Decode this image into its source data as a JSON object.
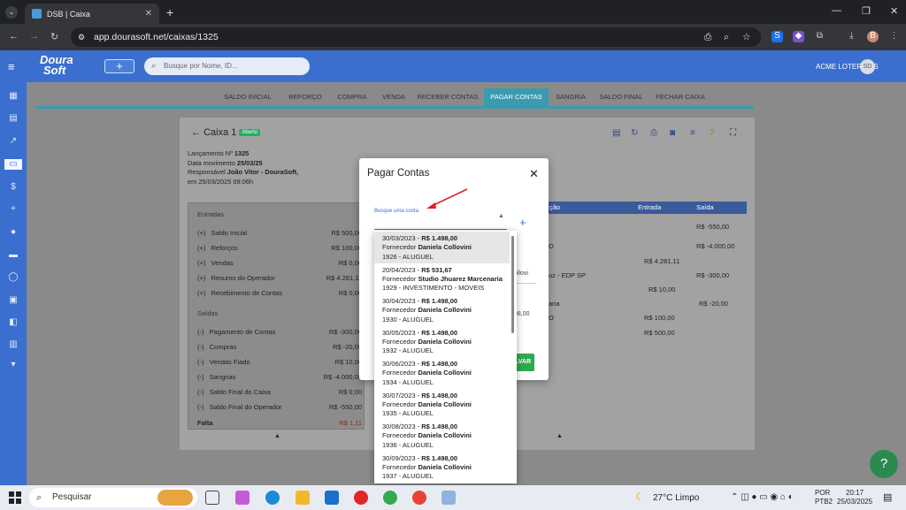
{
  "browser": {
    "tab_title": "DSB | Caixa",
    "url": "app.dourasoft.net/caixas/1325"
  },
  "app": {
    "logo_line1": "Doura",
    "logo_line2": "Soft",
    "add_label": "+",
    "search_placeholder": "Busque por Nome, ID...",
    "company": "ACME LOTERICAS",
    "avatar_initials": "SD"
  },
  "tabs": [
    "SALDO INICIAL",
    "REFORÇO",
    "COMPRA",
    "VENDA",
    "RECEBER CONTAS",
    "PAGAR CONTAS",
    "SANGRIA",
    "SALDO FINAL",
    "FECHAR CAIXA"
  ],
  "active_tab": "PAGAR CONTAS",
  "caixa": {
    "title": "Caixa 1",
    "status": "Aberto",
    "lancamento_label": "Lançamento Nº",
    "lancamento": "1325",
    "data_label": "Data movimento",
    "data": "25/03/25",
    "responsavel_label": "Responsável",
    "responsavel": "João Vitor - DouraSoft,",
    "em": "em 25/03/2025 09:06h"
  },
  "summary": {
    "entradas_label": "Entradas",
    "entradas": [
      {
        "sign": "(+)",
        "label": "Saldo Inicial",
        "value": "R$ 500,00"
      },
      {
        "sign": "(+)",
        "label": "Reforços",
        "value": "R$ 100,00"
      },
      {
        "sign": "(+)",
        "label": "Vendas",
        "value": "R$ 0,00"
      },
      {
        "sign": "(+)",
        "label": "Resumo do Operador",
        "value": "R$ 4.281,11"
      },
      {
        "sign": "(+)",
        "label": "Recebimento de Contas",
        "value": "R$ 0,00"
      }
    ],
    "saidas_label": "Saídas",
    "saidas": [
      {
        "sign": "(-)",
        "label": "Pagamento de Contas",
        "value": "R$ -300,00"
      },
      {
        "sign": "(-)",
        "label": "Compras",
        "value": "R$ -20,00"
      },
      {
        "sign": "(-)",
        "label": "Vendas Fiado",
        "value": "R$ 10,00"
      },
      {
        "sign": "(-)",
        "label": "Sangrias",
        "value": "R$ -4.000,00"
      },
      {
        "sign": "(-)",
        "label": "Saldo Final do Caixa",
        "value": "R$ 0,00"
      },
      {
        "sign": "(-)",
        "label": "Saldo Final do Operador",
        "value": "R$ -550,00"
      }
    ],
    "falta_label": "Falta",
    "falta_value": "R$ 1,11"
  },
  "table": {
    "headers": [
      "ção",
      "Entrada",
      "Saída"
    ],
    "rows": [
      {
        "desc": "",
        "entrada": "",
        "saida": "R$ -550,00"
      },
      {
        "desc": "O",
        "entrada": "",
        "saida": "R$ -4.000,00"
      },
      {
        "desc": "",
        "entrada": "R$ 4.281,11",
        "saida": ""
      },
      {
        "desc": "uz - EDP SP",
        "entrada": "",
        "saida": "R$ -300,00"
      },
      {
        "desc": "",
        "entrada": "R$ 10,00",
        "saida": ""
      },
      {
        "desc": "aria",
        "entrada": "",
        "saida": "R$ -20,00"
      },
      {
        "desc": "O",
        "entrada": "R$ 100,00",
        "saida": ""
      },
      {
        "desc": "",
        "entrada": "R$ 500,00",
        "saida": ""
      }
    ]
  },
  "modal": {
    "title": "Pagar Contas",
    "close": "✕",
    "label": "Busque uma conta",
    "bit1": "ollovi",
    "bit2": "98,00",
    "save": "LVAR"
  },
  "dropdown": [
    {
      "date": "30/03/2023",
      "amount": "R$ 1.498,00",
      "fornecedor_prefix": "Fornecedor",
      "fornecedor": "Daniela Collovini",
      "ref": "1926 - ALUGUEL",
      "highlighted": true
    },
    {
      "date": "20/04/2023",
      "amount": "R$ 531,67",
      "fornecedor_prefix": "Fornecedor",
      "fornecedor": "Studio Jhuarez Marcenaria",
      "ref": "1929 - INVESTIMENTO - MOVEIS",
      "highlighted": false
    },
    {
      "date": "30/04/2023",
      "amount": "R$ 1.498,00",
      "fornecedor_prefix": "Fornecedor",
      "fornecedor": "Daniela Collovini",
      "ref": "1930 - ALUGUEL",
      "highlighted": false
    },
    {
      "date": "30/05/2023",
      "amount": "R$ 1.498,00",
      "fornecedor_prefix": "Fornecedor",
      "fornecedor": "Daniela Collovini",
      "ref": "1932 - ALUGUEL",
      "highlighted": false
    },
    {
      "date": "30/06/2023",
      "amount": "R$ 1.498,00",
      "fornecedor_prefix": "Fornecedor",
      "fornecedor": "Daniela Collovini",
      "ref": "1934 - ALUGUEL",
      "highlighted": false
    },
    {
      "date": "30/07/2023",
      "amount": "R$ 1.498,00",
      "fornecedor_prefix": "Fornecedor",
      "fornecedor": "Daniela Collovini",
      "ref": "1935 - ALUGUEL",
      "highlighted": false
    },
    {
      "date": "30/08/2023",
      "amount": "R$ 1.498,00",
      "fornecedor_prefix": "Fornecedor",
      "fornecedor": "Daniela Collovini",
      "ref": "1936 - ALUGUEL",
      "highlighted": false
    },
    {
      "date": "30/09/2023",
      "amount": "R$ 1.498,00",
      "fornecedor_prefix": "Fornecedor",
      "fornecedor": "Daniela Collovini",
      "ref": "1937 - ALUGUEL",
      "highlighted": false
    }
  ],
  "taskbar": {
    "search": "Pesquisar",
    "weather": "27°C  Limpo",
    "lang1": "POR",
    "lang2": "PTB2",
    "time": "20:17",
    "date": "25/03/2025"
  },
  "colors": {
    "accent": "#3a6fd0",
    "tab_active": "#3a9bb0",
    "save": "#2eaa4f",
    "arrow": "#e0201c"
  }
}
